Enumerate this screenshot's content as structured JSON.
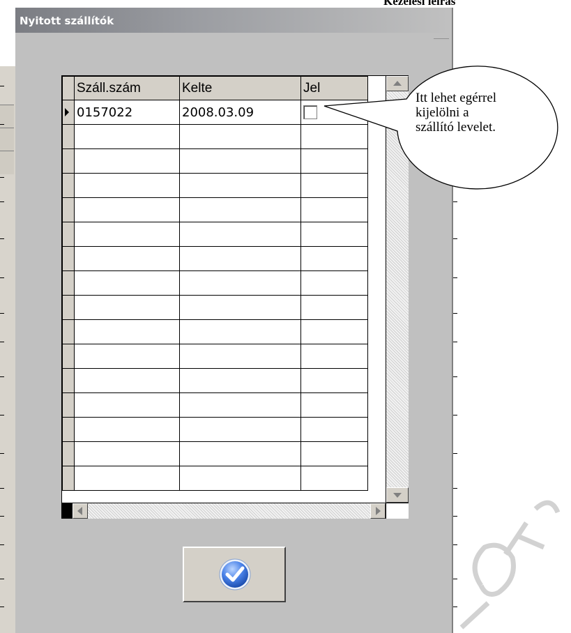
{
  "document": {
    "header": "Kezelési leírás"
  },
  "dialog": {
    "title": "Nyitott szállítók",
    "grid": {
      "columns": [
        "Száll.szám",
        "Kelte",
        "Jel"
      ],
      "rows": [
        {
          "szam": "0157022",
          "kelte": "2008.03.09",
          "jel": false
        }
      ],
      "empty_row_count": 15
    },
    "ok_button": {
      "icon": "checkmark-icon"
    }
  },
  "callout": {
    "lines": [
      "Itt lehet egérrel",
      "kijelölni a",
      "szállító levelet."
    ]
  },
  "colors": {
    "dialog_bg": "#c0c0c0",
    "header_bg": "#d4d0c8",
    "ok_icon_blue": "#3b6fd8"
  }
}
